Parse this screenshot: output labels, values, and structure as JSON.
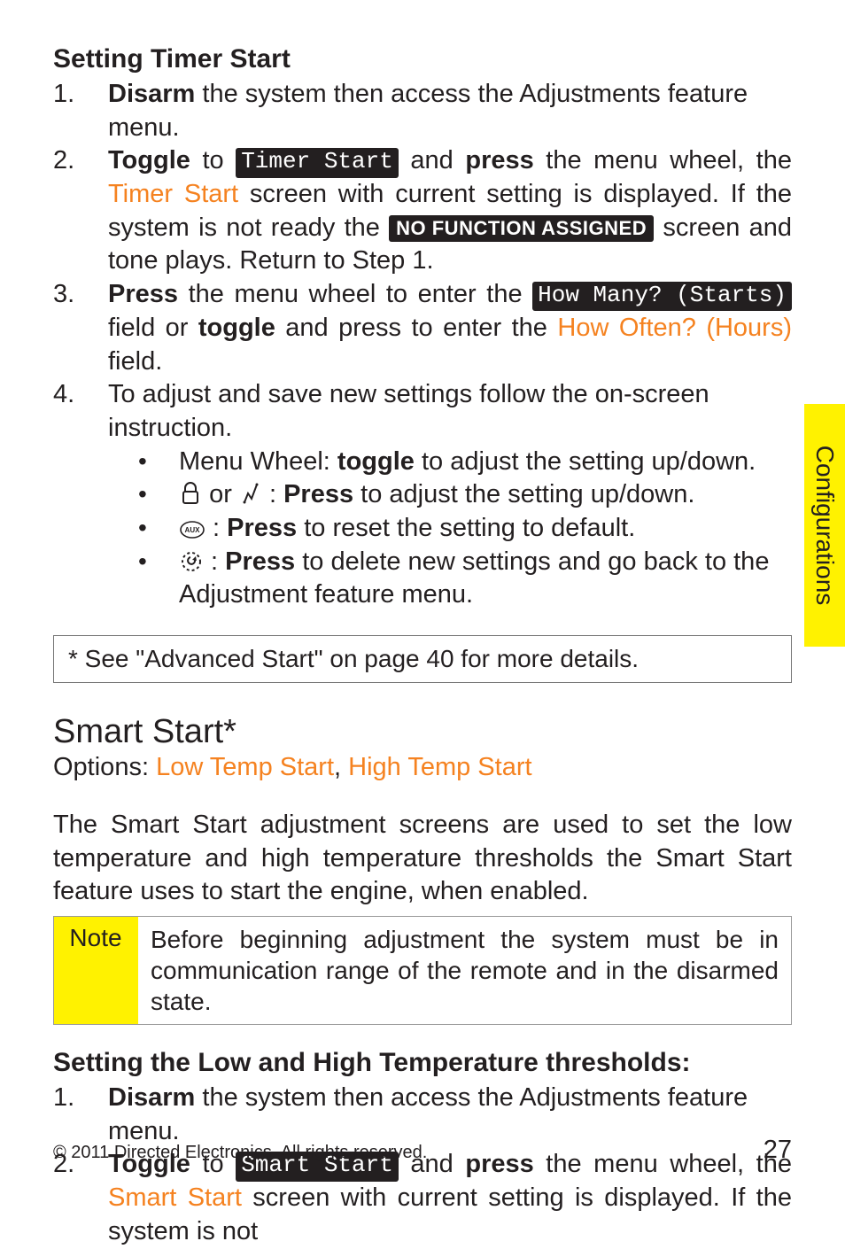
{
  "side_tab": "Configurations",
  "section1": {
    "subhead": "Setting Timer Start",
    "step1": {
      "num": "1.",
      "b1": "Disarm",
      "t1": " the system then access the Adjustments feature menu."
    },
    "step2": {
      "num": "2.",
      "b1": "Toggle",
      "t1": " to ",
      "tag1": "Timer Start",
      "t2": " and ",
      "b2": "press",
      "t3": " the menu wheel, the ",
      "o1": "Timer Start",
      "t4": " screen with current setting is displayed. If the system is not ready the ",
      "tag2": "NO FUNCTION ASSIGNED",
      "t5": " screen and tone plays. Return to Step 1."
    },
    "step3": {
      "num": "3.",
      "b1": "Press",
      "t1": " the menu wheel to enter the ",
      "tag1": "How Many? (Starts)",
      "t2": " field or ",
      "b2": "toggle",
      "t3": " and press to enter the ",
      "o1": "How Often? (Hours)",
      "t4": " field."
    },
    "step4": {
      "num": "4.",
      "t1": "To adjust and save new settings follow the on-screen instruction.",
      "bullets": {
        "b1a": "Menu Wheel: ",
        "b1b": "toggle",
        "b1c": " to adjust the setting up/down.",
        "b2a": "or",
        "b2b": "Press",
        "b2c": " to adjust the setting up/down.",
        "b3a": "Press",
        "b3b": " to reset the setting to default.",
        "b4a": "Press",
        "b4b": " to delete new settings and go back to the Adjustment feature menu."
      }
    },
    "footnote": "* See \"Advanced Start\" on page 40 for more details."
  },
  "section2": {
    "heading": "Smart Start*",
    "options_label": "Options: ",
    "option1": "Low Temp Start",
    "sep": ", ",
    "option2": "High Temp Start",
    "para": "The Smart Start adjustment screens are used to set the low temperature and high temperature thresholds the Smart Start feature uses to start the engine, when enabled.",
    "note_label": "Note",
    "note_body": "Before beginning adjustment the system must be in communication range of the remote and in the disarmed state.",
    "subhead2": "Setting the Low and High Temperature thresholds:",
    "step1": {
      "num": "1.",
      "b1": "Disarm",
      "t1": " the system then access the Adjustments feature menu."
    },
    "step2": {
      "num": "2.",
      "b1": "Toggle",
      "t1": " to ",
      "tag1": "Smart Start",
      "t2": " and ",
      "b2": "press",
      "t3": " the menu wheel, the ",
      "o1": "Smart Start",
      "t4": " screen with current setting is displayed. If the system is not"
    }
  },
  "footer": {
    "copyright": "© 2011 Directed Electronics. All rights reserved.",
    "page": "27"
  }
}
